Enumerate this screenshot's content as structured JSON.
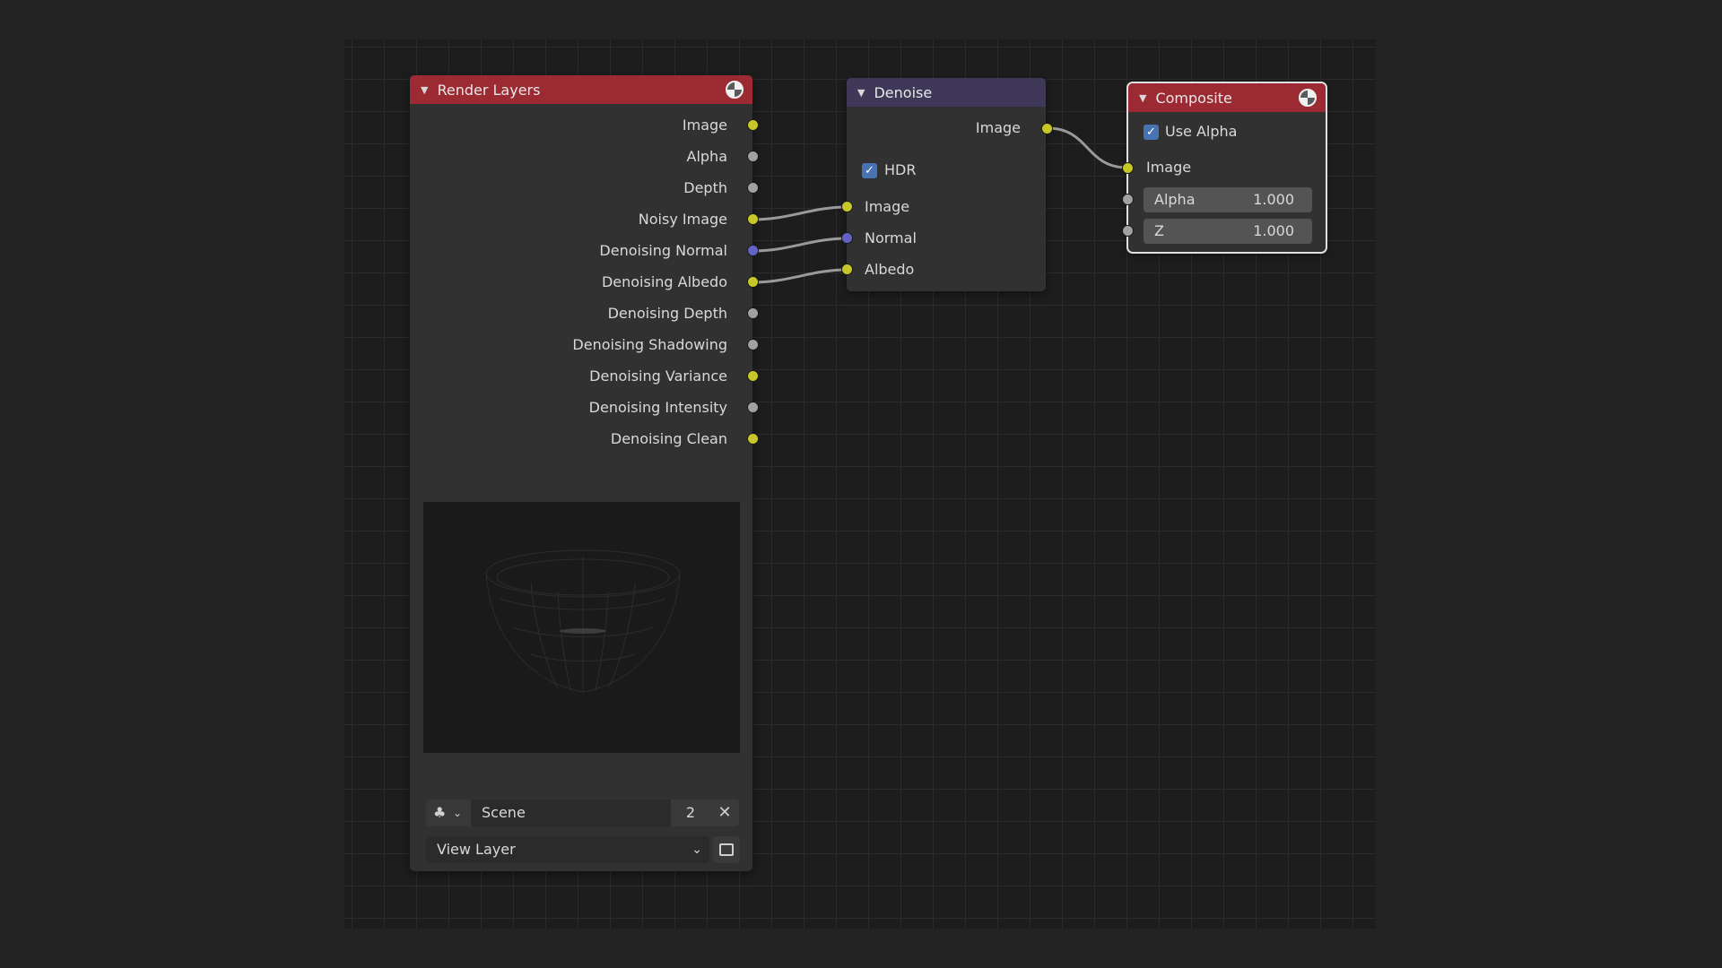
{
  "render_layers": {
    "title": "Render Layers",
    "outputs": [
      {
        "label": "Image",
        "socket": "yellow"
      },
      {
        "label": "Alpha",
        "socket": "gray"
      },
      {
        "label": "Depth",
        "socket": "gray"
      },
      {
        "label": "Noisy Image",
        "socket": "yellow"
      },
      {
        "label": "Denoising Normal",
        "socket": "purple"
      },
      {
        "label": "Denoising Albedo",
        "socket": "yellow"
      },
      {
        "label": "Denoising Depth",
        "socket": "gray"
      },
      {
        "label": "Denoising Shadowing",
        "socket": "gray"
      },
      {
        "label": "Denoising Variance",
        "socket": "yellow"
      },
      {
        "label": "Denoising Intensity",
        "socket": "gray"
      },
      {
        "label": "Denoising Clean",
        "socket": "yellow"
      }
    ],
    "scene_name": "Scene",
    "scene_users": "2",
    "view_layer": "View Layer"
  },
  "denoise": {
    "title": "Denoise",
    "output_label": "Image",
    "hdr_label": "HDR",
    "hdr_checked": true,
    "inputs": [
      {
        "label": "Image",
        "socket": "yellow"
      },
      {
        "label": "Normal",
        "socket": "purple"
      },
      {
        "label": "Albedo",
        "socket": "yellow"
      }
    ]
  },
  "composite": {
    "title": "Composite",
    "use_alpha_label": "Use Alpha",
    "use_alpha_checked": true,
    "image_label": "Image",
    "alpha_label": "Alpha",
    "alpha_value": "1.000",
    "z_label": "Z",
    "z_value": "1.000"
  },
  "colors": {
    "header_red": "#9b2a33",
    "header_purple": "#3f3858",
    "socket_yellow": "#c7c729",
    "socket_gray": "#a1a1a1",
    "socket_purple": "#6363c7",
    "checkbox_blue": "#4772b3"
  },
  "icons": {
    "collapse": "triangle-down-icon",
    "render": "render-sphere-icon",
    "scene": "scene-icon",
    "close": "close-icon",
    "render_layer": "render-layer-icon"
  }
}
